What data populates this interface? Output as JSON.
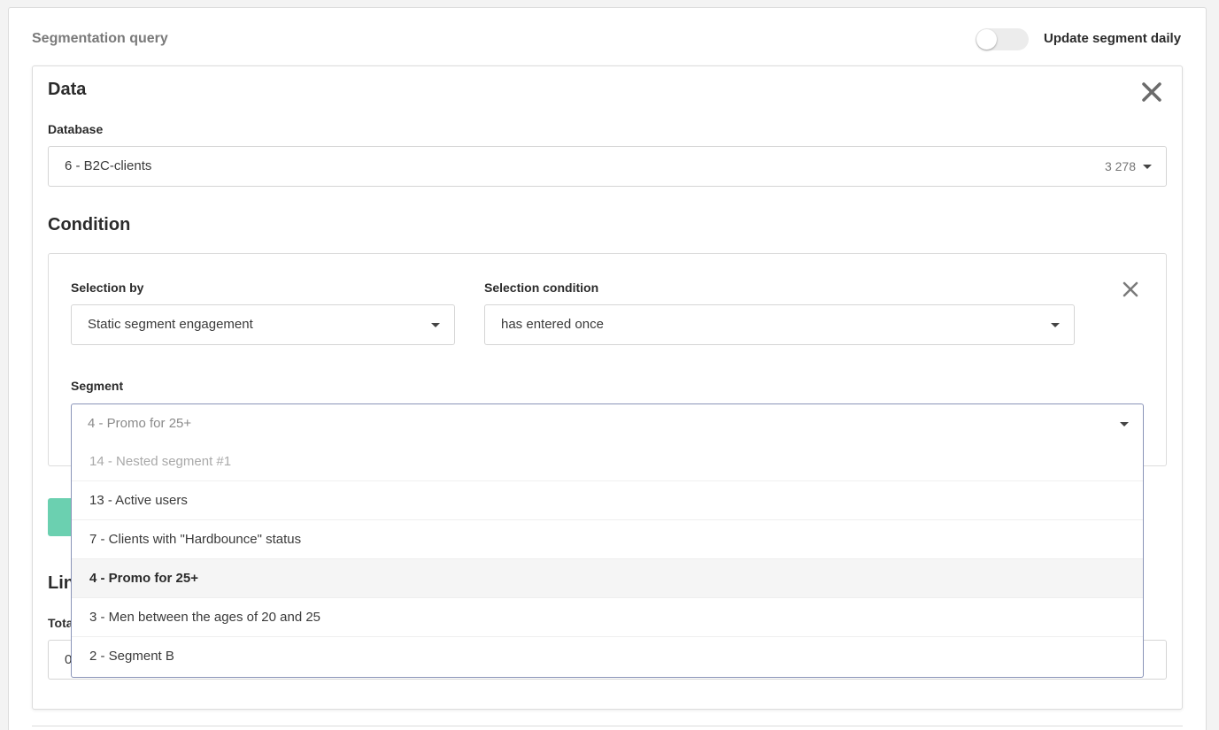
{
  "header": {
    "title": "Segmentation query",
    "toggle_label": "Update segment daily",
    "toggle_on": false
  },
  "data_section": {
    "title": "Data",
    "database_label": "Database",
    "database_value": "6 - B2C-clients",
    "database_count": "3 278"
  },
  "condition": {
    "title": "Condition",
    "selection_by_label": "Selection by",
    "selection_by_value": "Static segment engagement",
    "selection_condition_label": "Selection condition",
    "selection_condition_value": "has entered once",
    "segment_label": "Segment",
    "segment_value": "4 - Promo for 25+"
  },
  "dropdown": {
    "items": [
      {
        "label": "14 - Nested segment #1",
        "state": "disabled"
      },
      {
        "label": "13 - Active users",
        "state": "normal"
      },
      {
        "label": "7 - Clients with \"Hardbounce\" status",
        "state": "normal"
      },
      {
        "label": "4 - Promo for 25+",
        "state": "selected"
      },
      {
        "label": "3 - Men between the ages of 20 and 25",
        "state": "normal"
      },
      {
        "label": "2 - Segment B",
        "state": "normal"
      }
    ]
  },
  "limit": {
    "title_visible": "Lin",
    "total_label_visible": "Tota",
    "input_value_visible": "0"
  },
  "colors": {
    "accent_green": "#6bd0b0",
    "focus_border": "#8a94b8"
  }
}
